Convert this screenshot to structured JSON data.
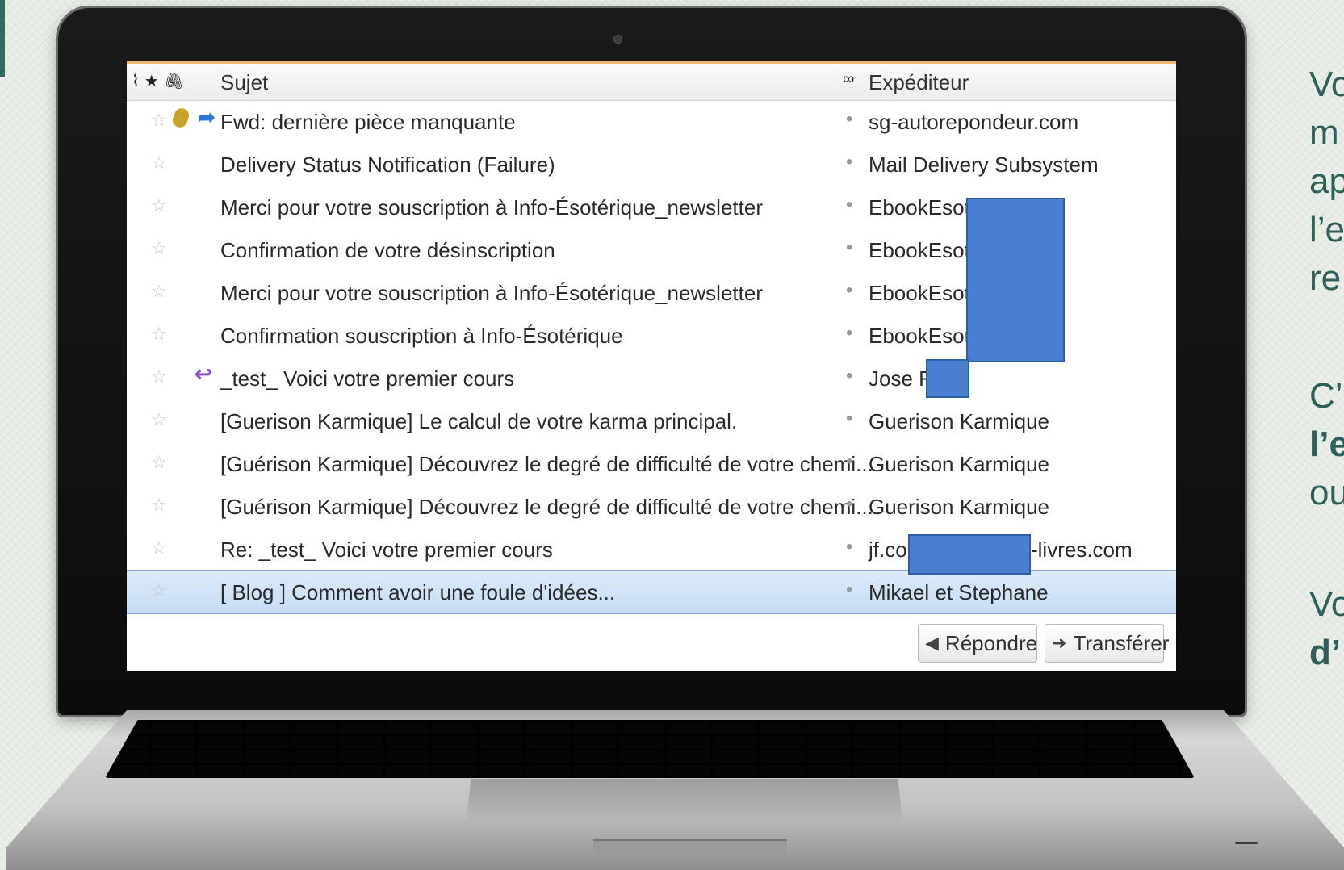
{
  "mail_list": {
    "header": {
      "icons": "⌇★🖇",
      "subject_label": "Sujet",
      "thread_icon": "∞",
      "sender_label": "Expéditeur"
    },
    "rows": [
      {
        "subject": "Fwd: dernière pièce manquante",
        "sender": "sg-autorepondeur.com"
      },
      {
        "subject": "Delivery Status Notification (Failure)",
        "sender": "Mail Delivery Subsystem"
      },
      {
        "subject": "Merci pour votre souscription à Info-Ésotérique_newsletter",
        "sender": "EbookEsote"
      },
      {
        "subject": "Confirmation de votre désinscription",
        "sender": "EbookEsote"
      },
      {
        "subject": "Merci pour votre souscription à Info-Ésotérique_newsletter",
        "sender": "EbookEsote"
      },
      {
        "subject": "Confirmation souscription à Info-Ésotérique",
        "sender": "EbookEsote"
      },
      {
        "subject": "_test_ Voici votre premier cours",
        "sender": "Jose Fr"
      },
      {
        "subject": "[Guerison Karmique] Le calcul de votre karma principal.",
        "sender": "Guerison Karmique"
      },
      {
        "subject": "[Guérison Karmique] Découvrez le degré de difficulté de votre chemi...",
        "sender": "Guerison Karmique"
      },
      {
        "subject": "[Guérison Karmique] Découvrez le degré de difficulté de votre chemi...",
        "sender": "Guerison Karmique"
      },
      {
        "subject": "Re: _test_ Voici votre premier cours",
        "sender": "jf.co",
        "sender_suffix": "-livres.com"
      },
      {
        "subject": "[ Blog ] Comment avoir une foule d'idées...",
        "sender": "Mikael et Stephane"
      }
    ],
    "buttons": {
      "reply": "Répondre",
      "forward": "Transférer"
    },
    "icons": {
      "star": "☆",
      "forward_arrow": "➦",
      "reply_arrow": "↩",
      "bullet": "•"
    }
  },
  "slide_text": {
    "line1": "Vo",
    "line2": "m",
    "line3": "ap",
    "line4": "l’e",
    "line5": "re",
    "line6": "C’",
    "line7": "l’e",
    "line8": "ou",
    "line9": "Vo",
    "line10": "d’"
  },
  "colors": {
    "selection": "#c6dcf4",
    "redaction": "#4a7fcf",
    "slide_text": "#2f5f59"
  }
}
